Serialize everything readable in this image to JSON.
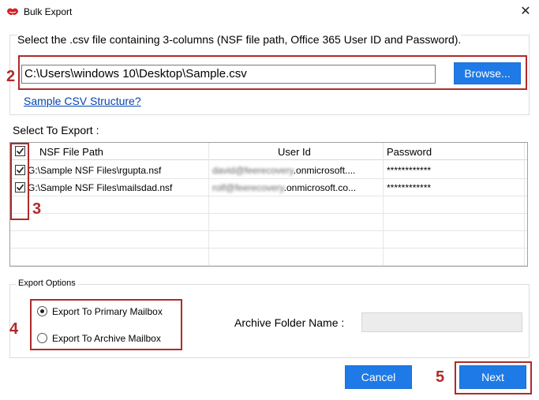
{
  "window": {
    "title": "Bulk Export",
    "close_glyph": "✕",
    "icon": "app-logo-icon"
  },
  "csv_section": {
    "instruction": "Select the .csv file containing 3-columns (NSF file path, Office 365 User ID and Password).",
    "file_path": "C:\\Users\\windows 10\\Desktop\\Sample.csv",
    "browse_label": "Browse...",
    "sample_link": "Sample CSV Structure?"
  },
  "select_section": {
    "label": "Select To Export :",
    "columns": [
      "NSF File Path",
      "User Id",
      "Password"
    ],
    "header_checked": true,
    "rows": [
      {
        "checked": true,
        "nsf_path": "G:\\Sample NSF Files\\rgupta.nsf",
        "user_prefix": "david@feerecovery",
        "user_suffix": ".onmicrosoft....",
        "password": "************"
      },
      {
        "checked": true,
        "nsf_path": "G:\\Sample NSF Files\\mailsdad.nsf",
        "user_prefix": "rolf@feerecovery",
        "user_suffix": ".onmicrosoft.co...",
        "password": "************"
      }
    ]
  },
  "export_options": {
    "legend": "Export Options",
    "primary_label": "Export To Primary Mailbox",
    "archive_label": "Export To Archive Mailbox",
    "selected": "primary",
    "archive_folder_label": "Archive Folder Name :",
    "archive_folder_value": ""
  },
  "buttons": {
    "cancel": "Cancel",
    "next": "Next"
  },
  "annotations": [
    "2",
    "3",
    "4",
    "5"
  ],
  "colors": {
    "accent_button": "#1e7ae6",
    "annotation_red": "#b02a2a",
    "link": "#0645ad"
  }
}
